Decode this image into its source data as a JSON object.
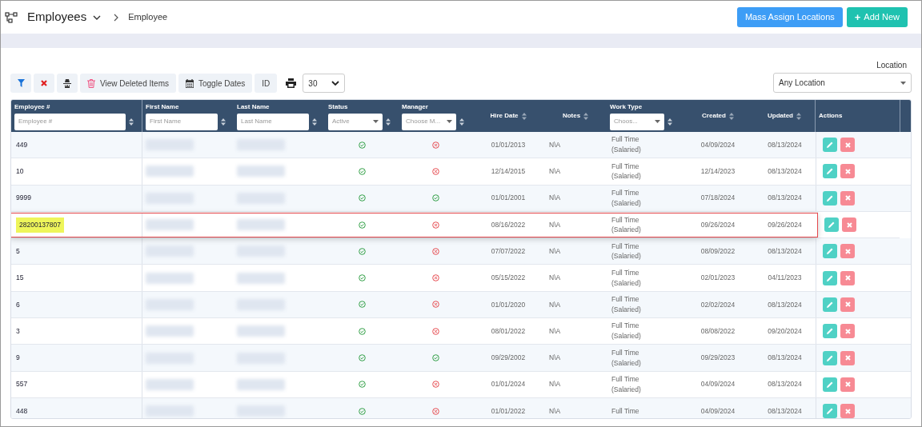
{
  "header": {
    "title": "Employees",
    "breadcrumb": "Employee",
    "buttons": [
      {
        "label": "Mass Assign Locations",
        "kind": "primary"
      },
      {
        "label": "Add New",
        "kind": "add",
        "icon": "+"
      }
    ]
  },
  "toolbar": {
    "tools": [
      {
        "kind": "filter"
      },
      {
        "kind": "clear"
      },
      {
        "kind": "spy"
      },
      {
        "kind": "deleted",
        "label": "View Deleted Items"
      },
      {
        "kind": "dates",
        "label": "Toggle Dates"
      },
      {
        "kind": "id",
        "label": "ID"
      }
    ],
    "page_size": "30",
    "location": {
      "label": "Location",
      "value": "Any Location"
    }
  },
  "table": {
    "columns": [
      {
        "label": "Employee #",
        "kind": "text",
        "placeholder": "Employee #"
      },
      {
        "label": "First Name",
        "kind": "text",
        "placeholder": "First Name"
      },
      {
        "label": "Last Name",
        "kind": "text",
        "placeholder": "Last Name"
      },
      {
        "label": "Status",
        "kind": "select",
        "placeholder": "Active"
      },
      {
        "label": "Manager",
        "kind": "select",
        "placeholder": "Choose M..."
      },
      {
        "label": "Hire Date",
        "kind": "sort"
      },
      {
        "label": "Notes",
        "kind": "sort"
      },
      {
        "label": "Work Type",
        "kind": "select",
        "placeholder": "Choos..."
      },
      {
        "label": "Created",
        "kind": "sort"
      },
      {
        "label": "Updated",
        "kind": "sort"
      },
      {
        "label": "Actions",
        "kind": "plain"
      }
    ],
    "rows": [
      {
        "number": "449",
        "active": true,
        "manager": false,
        "hire_date": "01/01/2013",
        "notes": "N\\A",
        "work_type": "Full Time (Salaried)",
        "created": "04/09/2024",
        "updated": "08/13/2024",
        "highlighted": false
      },
      {
        "number": "10",
        "active": true,
        "manager": false,
        "hire_date": "12/14/2015",
        "notes": "N\\A",
        "work_type": "Full Time (Salaried)",
        "created": "12/14/2023",
        "updated": "08/13/2024",
        "highlighted": false
      },
      {
        "number": "9999",
        "active": true,
        "manager": true,
        "hire_date": "01/01/2001",
        "notes": "N\\A",
        "work_type": "Full Time (Salaried)",
        "created": "07/18/2024",
        "updated": "08/13/2024",
        "highlighted": false
      },
      {
        "number": "28200137807",
        "active": true,
        "manager": false,
        "hire_date": "08/16/2022",
        "notes": "N\\A",
        "work_type": "Full Time (Salaried)",
        "created": "09/26/2024",
        "updated": "09/26/2024",
        "highlighted": true
      },
      {
        "number": "5",
        "active": true,
        "manager": false,
        "hire_date": "07/07/2022",
        "notes": "N\\A",
        "work_type": "Full Time (Salaried)",
        "created": "08/09/2022",
        "updated": "08/13/2024",
        "highlighted": false
      },
      {
        "number": "15",
        "active": true,
        "manager": false,
        "hire_date": "05/15/2022",
        "notes": "N\\A",
        "work_type": "Full Time (Salaried)",
        "created": "02/01/2023",
        "updated": "04/11/2023",
        "highlighted": false
      },
      {
        "number": "6",
        "active": true,
        "manager": false,
        "hire_date": "01/01/2020",
        "notes": "N\\A",
        "work_type": "Full Time (Salaried)",
        "created": "02/02/2024",
        "updated": "08/13/2024",
        "highlighted": false
      },
      {
        "number": "3",
        "active": true,
        "manager": false,
        "hire_date": "08/01/2022",
        "notes": "N\\A",
        "work_type": "Full Time (Salaried)",
        "created": "08/08/2022",
        "updated": "09/20/2024",
        "highlighted": false
      },
      {
        "number": "9",
        "active": true,
        "manager": true,
        "hire_date": "09/29/2002",
        "notes": "N\\A",
        "work_type": "Full Time (Salaried)",
        "created": "09/29/2023",
        "updated": "08/13/2024",
        "highlighted": false
      },
      {
        "number": "557",
        "active": true,
        "manager": false,
        "hire_date": "01/01/2024",
        "notes": "N\\A",
        "work_type": "Full Time (Salaried)",
        "created": "04/09/2024",
        "updated": "08/13/2024",
        "highlighted": false
      },
      {
        "number": "448",
        "active": true,
        "manager": false,
        "hire_date": "01/01/2022",
        "notes": "N\\A",
        "work_type": "Full Time",
        "created": "04/09/2024",
        "updated": "08/13/2024",
        "highlighted": false
      }
    ]
  }
}
